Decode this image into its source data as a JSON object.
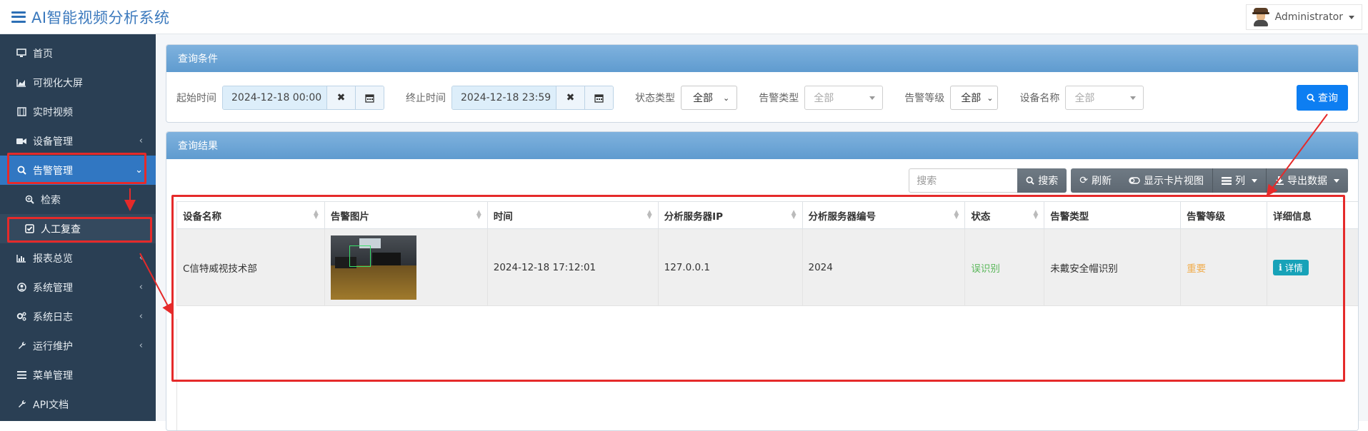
{
  "app": {
    "title": "AI智能视频分析系统",
    "user": "Administrator"
  },
  "sidebar": {
    "items": [
      {
        "label": "首页",
        "icon": "monitor-icon"
      },
      {
        "label": "可视化大屏",
        "icon": "area-chart-icon"
      },
      {
        "label": "实时视频",
        "icon": "film-icon"
      },
      {
        "label": "设备管理",
        "icon": "video-camera-icon",
        "expandable": true
      },
      {
        "label": "告警管理",
        "icon": "search-icon",
        "expanded": true
      },
      {
        "label": "检索",
        "icon": "search-plus-icon",
        "sub": true
      },
      {
        "label": "人工复查",
        "icon": "check-square-icon",
        "sub": true,
        "active": true
      },
      {
        "label": "报表总览",
        "icon": "bar-chart-icon",
        "expandable": true
      },
      {
        "label": "系统管理",
        "icon": "user-circle-icon",
        "expandable": true
      },
      {
        "label": "系统日志",
        "icon": "cogs-icon",
        "expandable": true
      },
      {
        "label": "运行维护",
        "icon": "wrench-icon",
        "expandable": true
      },
      {
        "label": "菜单管理",
        "icon": "list-icon"
      },
      {
        "label": "API文档",
        "icon": "wrench-icon"
      }
    ]
  },
  "query_panel": {
    "title": "查询条件",
    "start_label": "起始时间",
    "start_value": "2024-12-18 00:00",
    "end_label": "终止时间",
    "end_value": "2024-12-18 23:59",
    "status_label": "状态类型",
    "status_value": "全部",
    "alarm_type_label": "告警类型",
    "alarm_type_value": "全部",
    "alarm_level_label": "告警等级",
    "alarm_level_value": "全部",
    "device_label": "设备名称",
    "device_value": "全部",
    "query_button": "查询"
  },
  "result_panel": {
    "title": "查询结果",
    "search_placeholder": "搜索",
    "search_button": "搜索",
    "refresh_button": "刷新",
    "card_view_button": "显示卡片视图",
    "columns_button": "列",
    "export_button": "导出数据",
    "columns": [
      "设备名称",
      "告警图片",
      "时间",
      "分析服务器IP",
      "分析服务器编号",
      "状态",
      "告警类型",
      "告警等级",
      "详细信息"
    ],
    "rows": [
      {
        "device": "C信特威视技术部",
        "time": "2024-12-18 17:12:01",
        "server_ip": "127.0.0.1",
        "server_no": "2024",
        "status": "误识别",
        "alarm_type": "未戴安全帽识别",
        "level": "重要",
        "detail": "详情"
      }
    ]
  },
  "colors": {
    "accent": "#3177c2",
    "sidebar_bg": "#2a3f54",
    "highlight_red": "#e52a2a"
  }
}
